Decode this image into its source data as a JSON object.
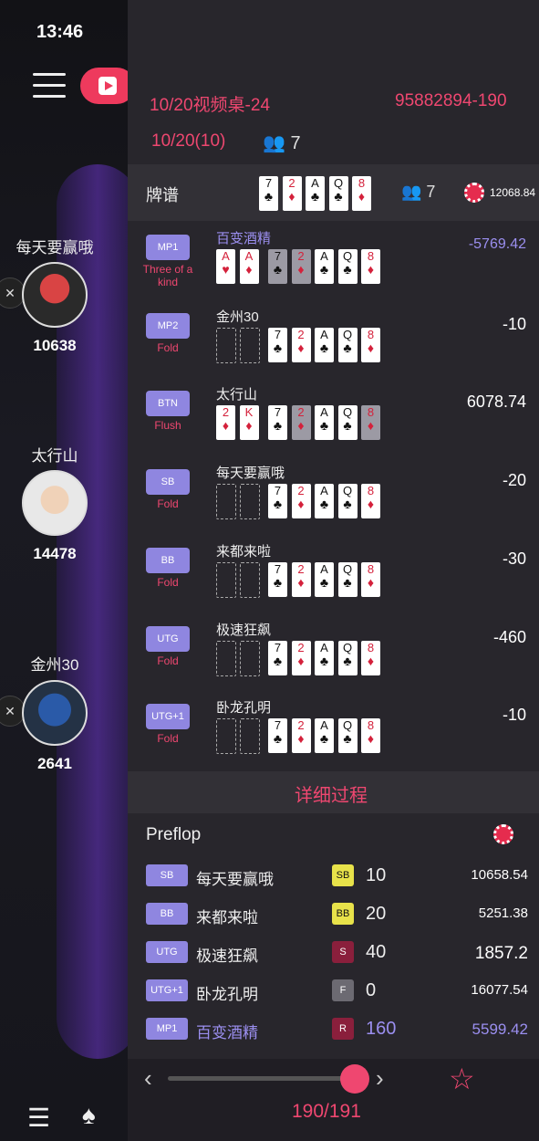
{
  "status_bar": {
    "time": "13:46"
  },
  "left_players": [
    {
      "name": "每天要赢哦",
      "chips": "10638"
    },
    {
      "name": "太行山",
      "chips": "14478"
    },
    {
      "name": "金州30",
      "chips": "2641"
    }
  ],
  "header": {
    "title": "10/20视频桌-24",
    "hand_id": "95882894-190",
    "subtitle": "10/20(10)",
    "players_count": "7"
  },
  "board": {
    "label": "牌谱",
    "players_count": "7",
    "pot": "12068.84",
    "cards": [
      {
        "rank": "7",
        "suit": "♣"
      },
      {
        "rank": "2",
        "suit": "♦"
      },
      {
        "rank": "A",
        "suit": "♣"
      },
      {
        "rank": "Q",
        "suit": "♣"
      },
      {
        "rank": "8",
        "suit": "♦"
      }
    ]
  },
  "results": [
    {
      "position": "MP1",
      "action": "Three of a kind",
      "name": "百变酒精",
      "amount": "-5769.42",
      "hole": [
        {
          "rank": "A",
          "suit": "♥"
        },
        {
          "rank": "A",
          "suit": "♦"
        }
      ],
      "highlight": true
    },
    {
      "position": "MP2",
      "action": "Fold",
      "name": "金州30",
      "amount": "-10",
      "hole": []
    },
    {
      "position": "BTN",
      "action": "Flush",
      "name": "太行山",
      "amount": "6078.74",
      "hole": [
        {
          "rank": "2",
          "suit": "♦"
        },
        {
          "rank": "K",
          "suit": "♦"
        }
      ]
    },
    {
      "position": "SB",
      "action": "Fold",
      "name": "每天要赢哦",
      "amount": "-20",
      "hole": []
    },
    {
      "position": "BB",
      "action": "Fold",
      "name": "来都来啦",
      "amount": "-30",
      "hole": []
    },
    {
      "position": "UTG",
      "action": "Fold",
      "name": "极速狂飙",
      "amount": "-460",
      "hole": []
    },
    {
      "position": "UTG+1",
      "action": "Fold",
      "name": "卧龙孔明",
      "amount": "-10",
      "hole": []
    }
  ],
  "detail_label": "详细过程",
  "street": "Preflop",
  "log": [
    {
      "position": "SB",
      "name": "每天要赢哦",
      "act": "SB",
      "act_color": "#e8e24a",
      "amount": "10",
      "stack": "10658.54"
    },
    {
      "position": "BB",
      "name": "来都来啦",
      "act": "BB",
      "act_color": "#e8e24a",
      "amount": "20",
      "stack": "5251.38"
    },
    {
      "position": "UTG",
      "name": "极速狂飙",
      "act": "S",
      "act_color": "#8a1f3c",
      "amount": "40",
      "stack": "1857.2"
    },
    {
      "position": "UTG+1",
      "name": "卧龙孔明",
      "act": "F",
      "act_color": "#6c6a72",
      "amount": "0",
      "stack": "16077.54"
    },
    {
      "position": "MP1",
      "name": "百变酒精",
      "act": "R",
      "act_color": "#8a1f3c",
      "amount": "160",
      "stack": "5599.42",
      "highlight": true
    }
  ],
  "footer": {
    "counter": "190/191"
  }
}
